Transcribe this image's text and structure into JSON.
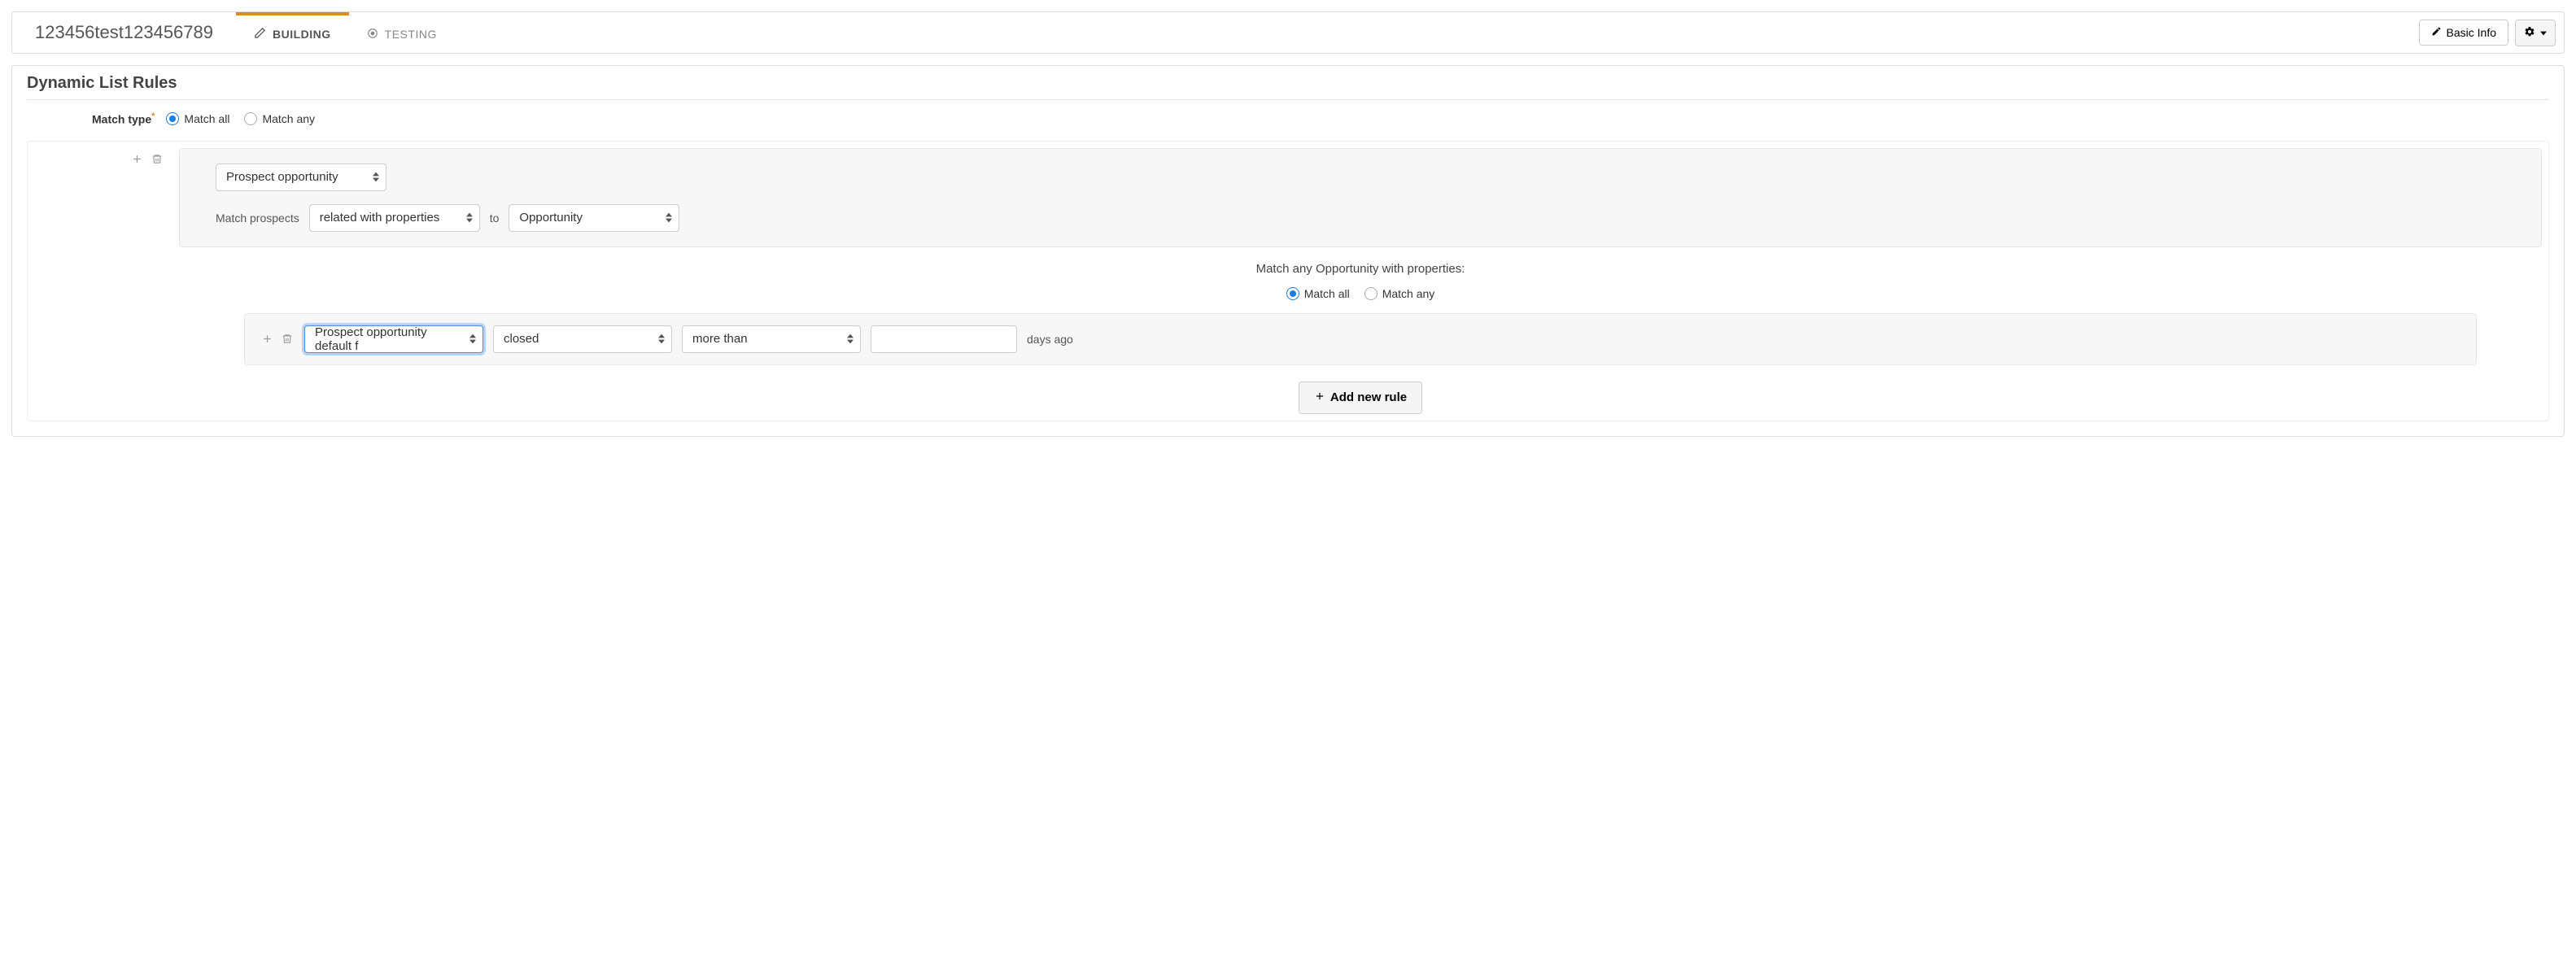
{
  "header": {
    "title": "123456test123456789",
    "tabs": {
      "building": "BUILDING",
      "testing": "TESTING"
    },
    "basic_info": "Basic Info"
  },
  "panel": {
    "title": "Dynamic List Rules",
    "match_type_label": "Match type",
    "match_all": "Match all",
    "match_any": "Match any"
  },
  "rule": {
    "category": "Prospect opportunity",
    "match_prospects_label": "Match prospects",
    "relation": "related with properties",
    "to_label": "to",
    "target": "Opportunity",
    "property_heading": "Match any Opportunity with properties:",
    "prop_match_all": "Match all",
    "prop_match_any": "Match any",
    "field": "Prospect opportunity default f",
    "status": "closed",
    "comparator": "more than",
    "days_value": "",
    "days_suffix": "days ago"
  },
  "actions": {
    "add_rule": "Add new rule"
  }
}
